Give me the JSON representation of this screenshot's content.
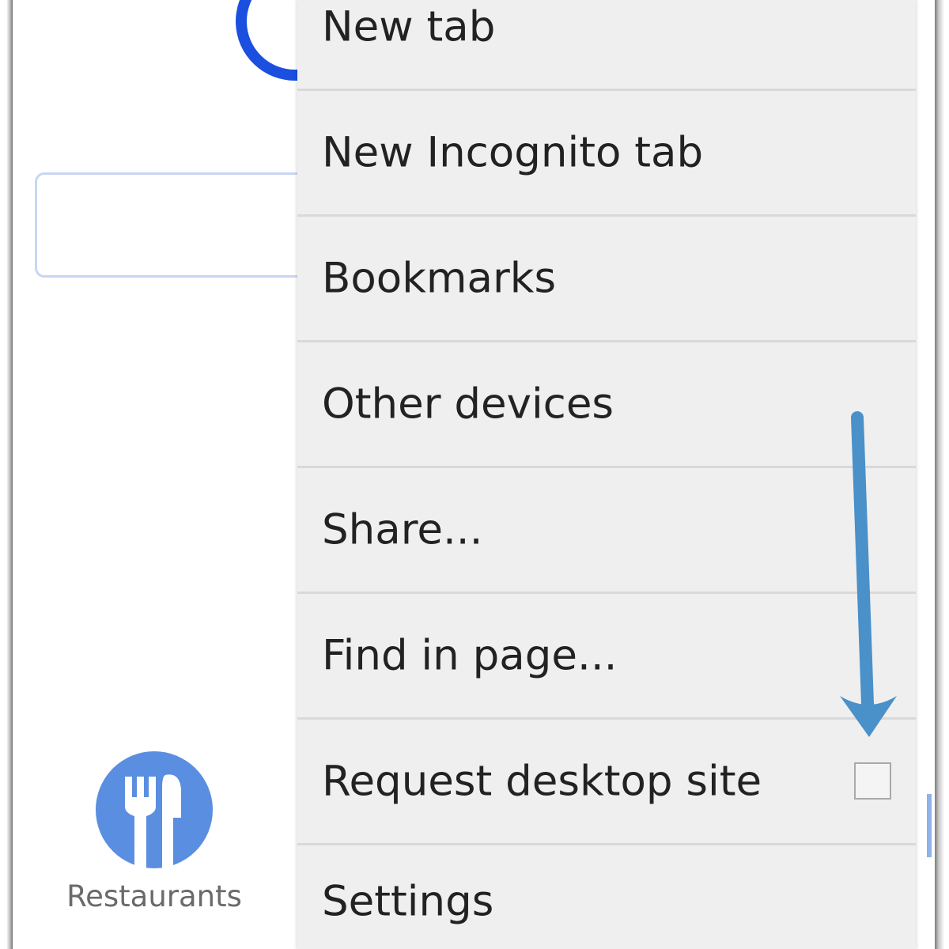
{
  "background_page": {
    "tiles": [
      {
        "label": "Restaurants",
        "icon": "fork-knife-icon"
      }
    ],
    "accent_color": "#5a8ee0",
    "logo_color": "#1a4fe0"
  },
  "menu": {
    "items": [
      {
        "label": "New tab"
      },
      {
        "label": "New Incognito tab"
      },
      {
        "label": "Bookmarks"
      },
      {
        "label": "Other devices"
      },
      {
        "label": "Share..."
      },
      {
        "label": "Find in page..."
      },
      {
        "label": "Request desktop site",
        "checkbox": false
      },
      {
        "label": "Settings"
      }
    ],
    "background_color": "#efefef"
  },
  "annotation": {
    "type": "arrow",
    "direction": "down",
    "points_to": "Request desktop site checkbox",
    "color": "#4a90c9"
  }
}
